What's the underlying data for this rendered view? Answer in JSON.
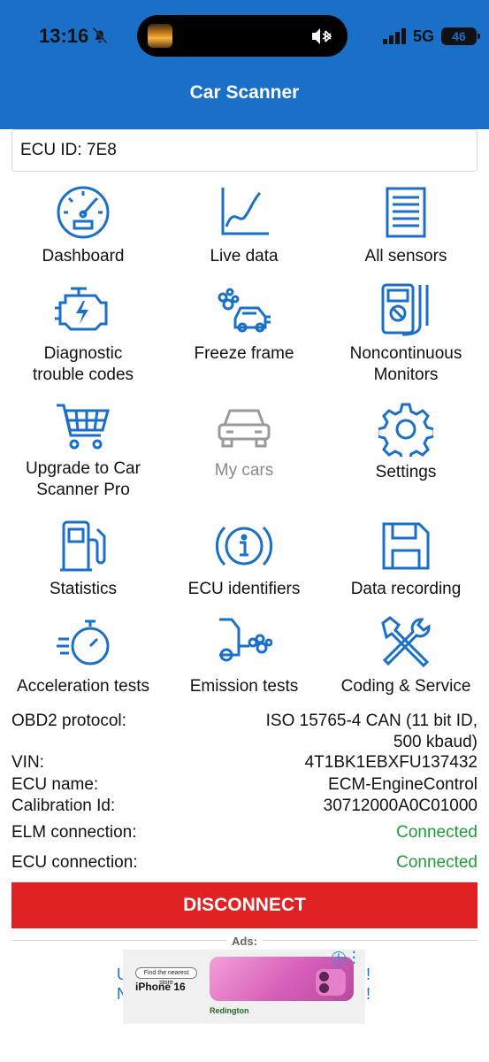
{
  "status_bar": {
    "time": "13:16",
    "network": "5G",
    "battery": "46",
    "icons": [
      "bell-slash-icon",
      "bluetooth-icon",
      "signal-icon"
    ]
  },
  "app": {
    "title": "Car Scanner"
  },
  "ecu": {
    "id_text": "ECU ID: 7E8"
  },
  "menu": [
    {
      "label": "Dashboard",
      "icon": "speedometer-icon"
    },
    {
      "label": "Live data",
      "icon": "line-chart-icon"
    },
    {
      "label": "All sensors",
      "icon": "list-document-icon"
    },
    {
      "label": "Diagnostic\ntrouble codes",
      "icon": "engine-icon"
    },
    {
      "label": "Freeze frame",
      "icon": "car-crash-icon"
    },
    {
      "label": "Noncontinuous\nMonitors",
      "icon": "multimeter-icon"
    },
    {
      "label": "Upgrade to Car\nScanner Pro",
      "icon": "shopping-cart-icon"
    },
    {
      "label": "My cars",
      "icon": "car-front-icon"
    },
    {
      "label": "Settings",
      "icon": "gear-icon"
    },
    {
      "label": "Statistics",
      "icon": "fuel-pump-icon"
    },
    {
      "label": "ECU identifiers",
      "icon": "info-icon"
    },
    {
      "label": "Data recording",
      "icon": "floppy-disk-icon"
    },
    {
      "label": "Acceleration tests",
      "icon": "stopwatch-icon"
    },
    {
      "label": "Emission tests",
      "icon": "exhaust-icon"
    },
    {
      "label": "Coding & Service",
      "icon": "tools-icon"
    }
  ],
  "info": {
    "obd_label": "OBD2 protocol:",
    "obd_value_line1": "ISO 15765-4 CAN (11 bit ID,",
    "obd_value_line2": "500 kbaud)",
    "vin_label": "VIN:",
    "vin_value": "4T1BK1EBXFU137432",
    "ecu_name_label": "ECU name:",
    "ecu_name_value": "ECM-EngineControl",
    "calibration_label": "Calibration Id:",
    "calibration_value": "30712000A0C01000",
    "elm_label": "ELM connection:",
    "elm_value": "Connected",
    "ecu_conn_label": "ECU connection:",
    "ecu_conn_value": "Connected"
  },
  "disconnect_label": "DISCONNECT",
  "ads": {
    "label": "Ads:",
    "pill": "Find the nearest store",
    "brand": "iPhone 16",
    "footer": "Redington",
    "info_glyph": "i",
    "edge_left": "U\nN",
    "edge_right": "!\n!"
  },
  "colors": {
    "header": "#1a6fc8",
    "icon_blue": "#1a6fc8",
    "connected": "#1f9c3a",
    "disconnect": "#e02222"
  }
}
